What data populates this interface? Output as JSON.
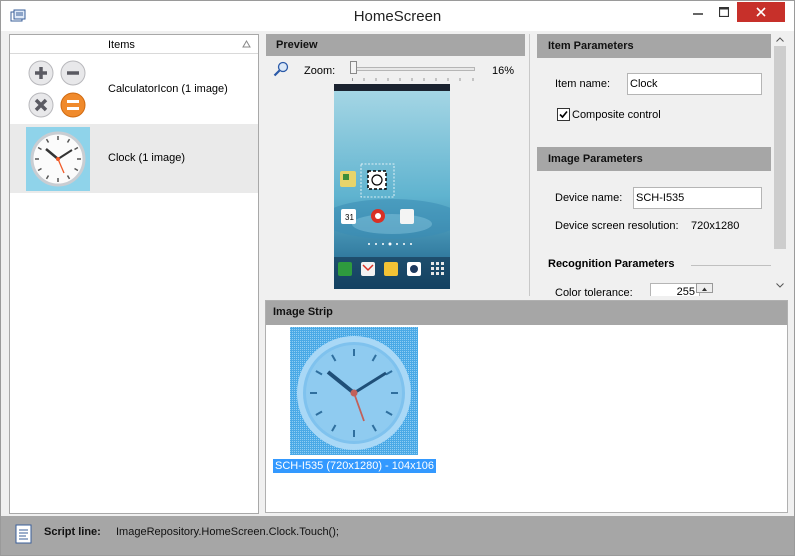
{
  "window": {
    "title": "HomeScreen",
    "minimize_icon": "minimize-icon",
    "maximize_icon": "maximize-icon",
    "close_icon": "close-icon"
  },
  "items_panel": {
    "header": "Items",
    "sort_icon": "sort-ascending-icon",
    "items": [
      {
        "label": "CalculatorIcon (1 image)",
        "icon": "calculator-icon"
      },
      {
        "label": "Clock (1 image)",
        "icon": "clock-icon"
      }
    ]
  },
  "preview": {
    "header": "Preview",
    "zoom_label": "Zoom:",
    "zoom_value": "16%",
    "zoom_icon": "zoom-icon"
  },
  "item_parameters": {
    "header": "Item Parameters",
    "item_name_label": "Item name:",
    "item_name_value": "Clock",
    "composite_control_label": "Composite control",
    "composite_control_checked": true
  },
  "image_parameters": {
    "header": "Image Parameters",
    "device_name_label": "Device name:",
    "device_name_value": "SCH-I535",
    "screen_resolution_label": "Device screen resolution:",
    "screen_resolution_value": "720x1280"
  },
  "recognition_parameters": {
    "header": "Recognition Parameters",
    "color_tolerance_label": "Color tolerance:",
    "color_tolerance_value": "255"
  },
  "image_strip": {
    "header": "Image Strip",
    "images": [
      {
        "caption": "SCH-I535 (720x1280) - 104x106"
      }
    ]
  },
  "status": {
    "script_label": "Script line:",
    "script_value": "ImageRepository.HomeScreen.Clock.Touch();"
  },
  "colors": {
    "header_gray": "#a6a6a6",
    "selection_blue": "#3399ff",
    "close_red": "#c7302a",
    "clock_tile_blue": "#8fd3ea"
  }
}
